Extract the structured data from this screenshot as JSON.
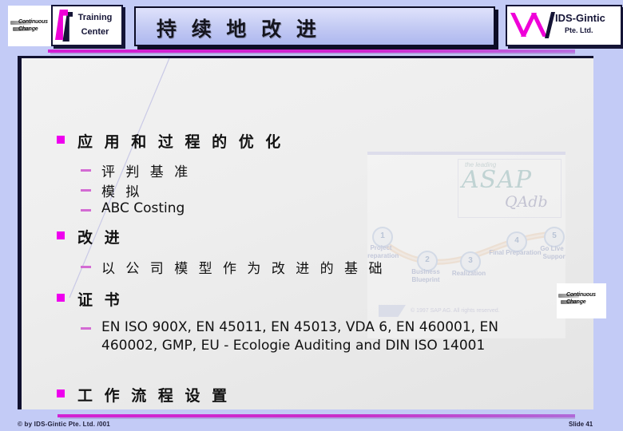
{
  "header": {
    "left_logo": {
      "line1": "Continuous",
      "line2": "Change",
      "name": "continuous-change-logo"
    },
    "training_center": {
      "line1": "Training",
      "line2": "Center"
    },
    "title": "持 续 地 改 进",
    "company_logo": {
      "name": "IDS-Gintic",
      "subtitle": "Pte. Ltd."
    }
  },
  "content": {
    "bullets": [
      {
        "label": "应 用 和 过 程 的 优 化",
        "sub": [
          {
            "text": "评 判 基 准",
            "script": "cn"
          },
          {
            "text": "模 拟",
            "script": "cn"
          },
          {
            "text": "ABC Costing",
            "script": "lat"
          }
        ]
      },
      {
        "label": "改 进",
        "sub": [
          {
            "text": "以 公 司 模 型 作 为 改 进 的 基 础",
            "script": "cn"
          }
        ]
      },
      {
        "label": "证 书",
        "sub": [
          {
            "text": "EN ISO 900X, EN 45011, EN 45013, VDA 6, EN 460001, EN 460002, GMP, EU - Ecologie Auditing and  DIN ISO 14001",
            "script": "lat"
          }
        ]
      },
      {
        "label": "工 作 流 程 设 置",
        "sub": []
      }
    ]
  },
  "graphic": {
    "logo_script": "the leading",
    "logo_main": "ASAP",
    "logo_sub": "QAdb",
    "roadmap": [
      {
        "num": "1",
        "label": "Project Preparation"
      },
      {
        "num": "2",
        "label": "Business Blueprint"
      },
      {
        "num": "3",
        "label": "Realization"
      },
      {
        "num": "4",
        "label": "Final Preparation"
      },
      {
        "num": "5",
        "label": "Go Live & Support"
      }
    ],
    "copyright": "© 1997 SAP AG. All rights reserved."
  },
  "watermark": {
    "line1": "Continuous",
    "line2": "Change"
  },
  "footer": {
    "left": "© by IDS-Gintic Pte. Ltd. /001",
    "right": "Slide 41"
  },
  "colors": {
    "magenta": "#ee00ee",
    "dash": "#d36bd3",
    "dark_navy": "#10102e",
    "slide_bg": "#c3cbf6"
  }
}
